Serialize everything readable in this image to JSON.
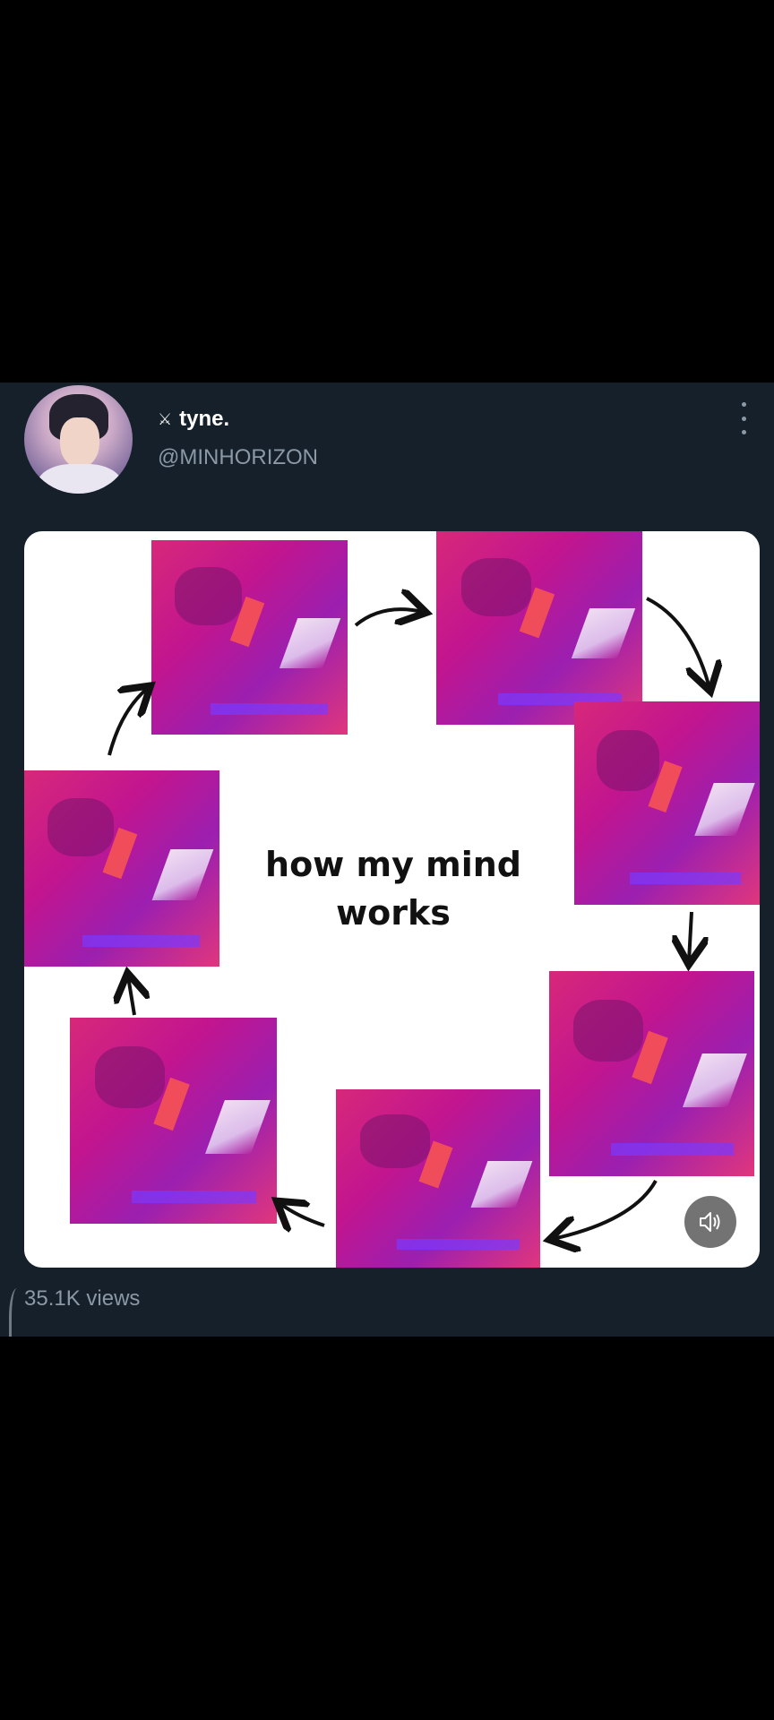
{
  "tweet": {
    "display_name": "tyne.",
    "name_emoji": "⚔",
    "handle": "@MINHORIZON",
    "media_caption_line1": "how my mind",
    "media_caption_line2": "works",
    "views": "35.1K views"
  },
  "icons": {
    "more": "more-vertical-icon",
    "sound": "speaker-unmute-icon"
  },
  "colors": {
    "background": "#000000",
    "card": "#15202b",
    "primary_text": "#ffffff",
    "secondary_text": "#8b98a5",
    "frame_pink": "#d7287a",
    "frame_purple": "#9b1fb0"
  }
}
